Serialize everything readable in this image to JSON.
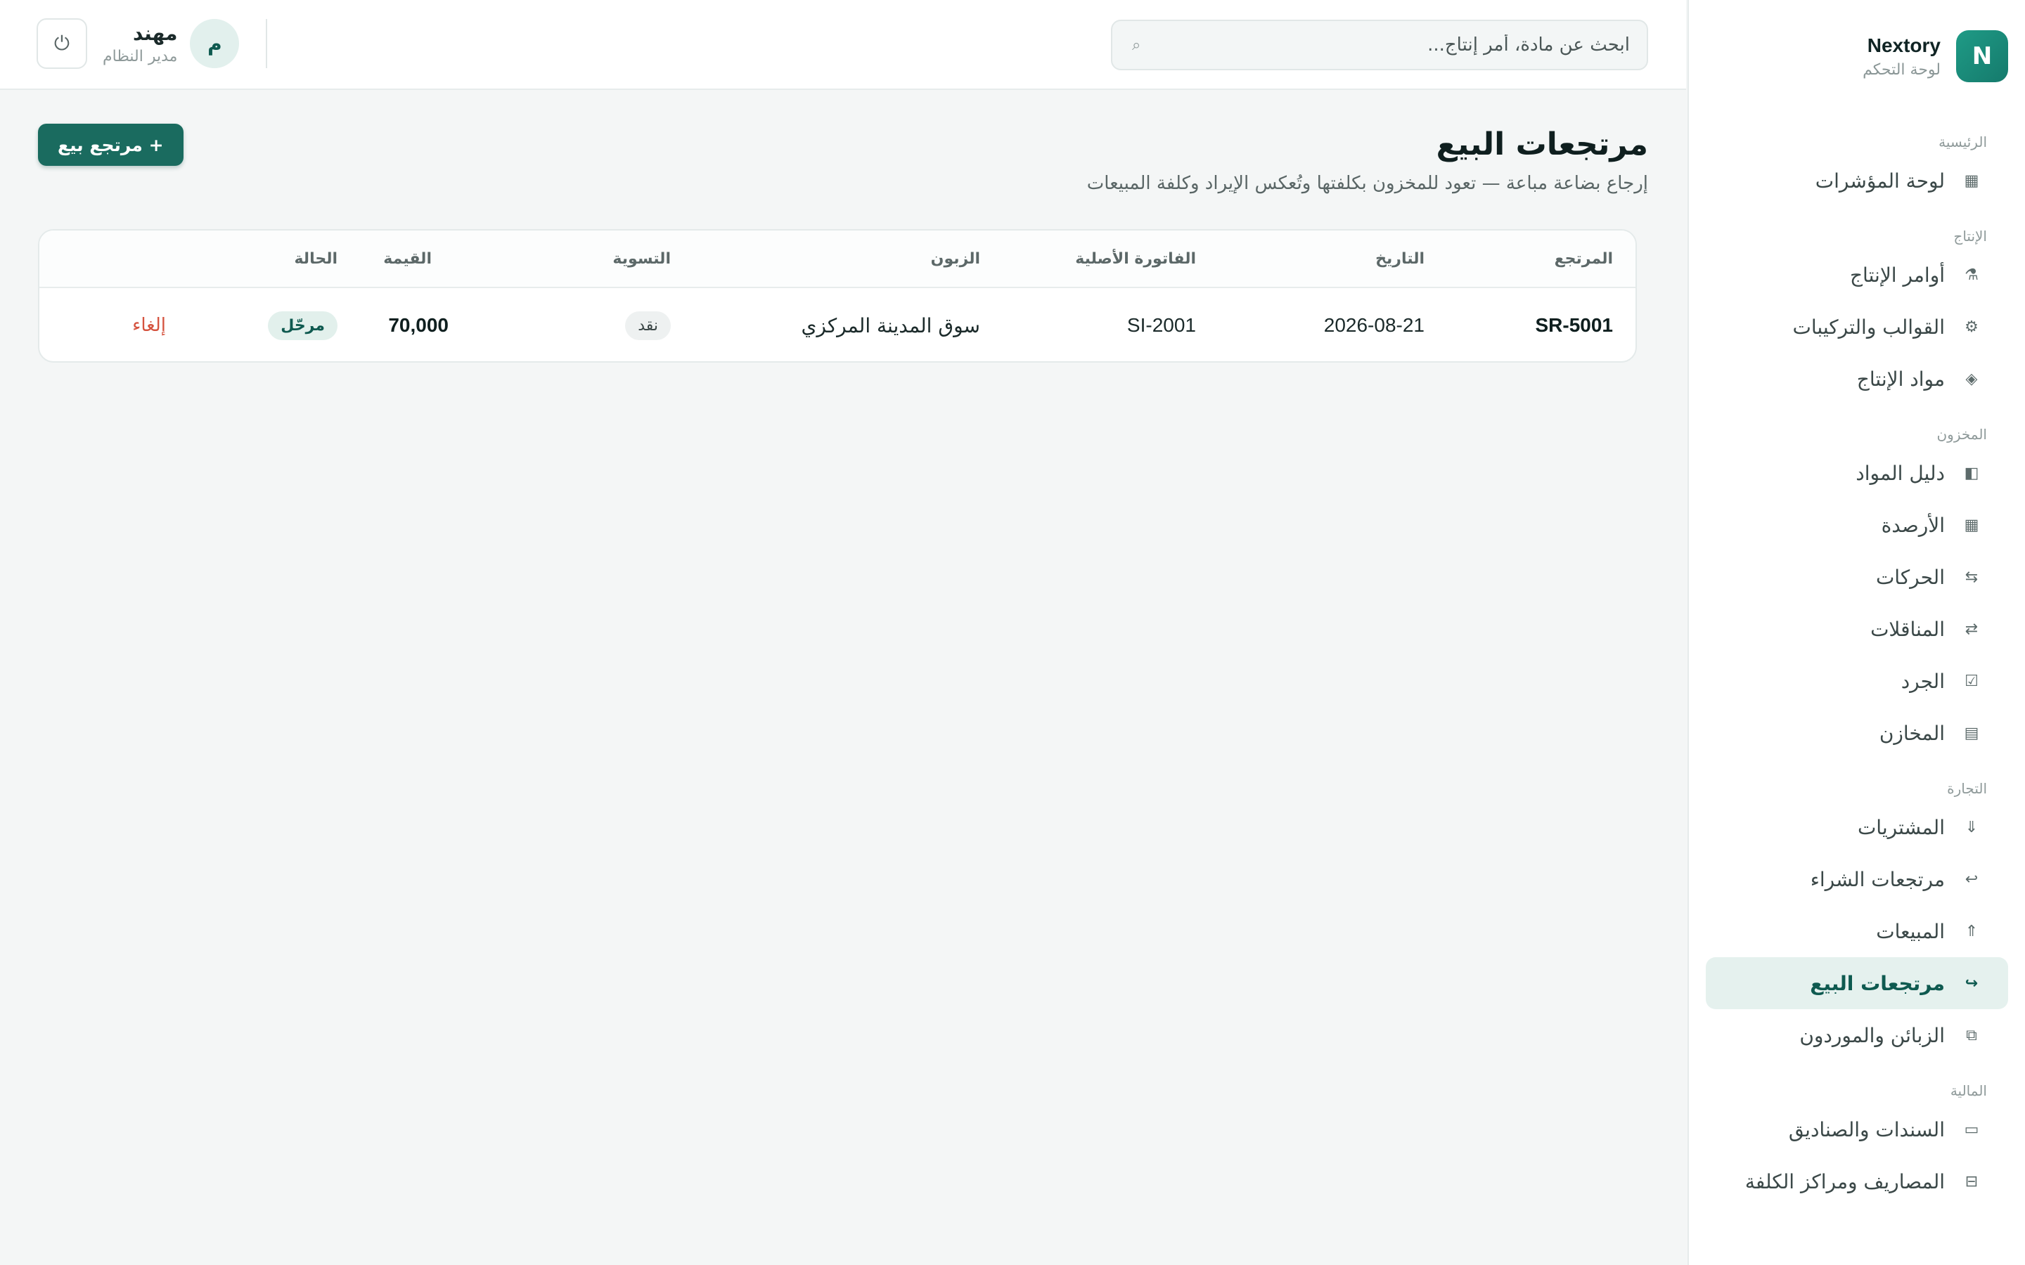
{
  "brand": {
    "logo_letter": "N",
    "name": "Nextory",
    "subtitle": "لوحة التحكم"
  },
  "sidebar": {
    "sections": [
      {
        "heading": "الرئيسية",
        "items": [
          {
            "label": "لوحة المؤشرات",
            "icon": "grid-icon",
            "glyph": "▦"
          }
        ]
      },
      {
        "heading": "الإنتاج",
        "items": [
          {
            "label": "أوامر الإنتاج",
            "icon": "factory-icon",
            "glyph": "⚗"
          },
          {
            "label": "القوالب والتركيبات",
            "icon": "gear-icon",
            "glyph": "⚙"
          },
          {
            "label": "مواد الإنتاج",
            "icon": "diamond-icon",
            "glyph": "◈"
          }
        ]
      },
      {
        "heading": "المخزون",
        "items": [
          {
            "label": "دليل المواد",
            "icon": "book-icon",
            "glyph": "◧"
          },
          {
            "label": "الأرصدة",
            "icon": "grid-icon",
            "glyph": "▦"
          },
          {
            "label": "الحركات",
            "icon": "movements-icon",
            "glyph": "⇆"
          },
          {
            "label": "المناقلات",
            "icon": "transfer-icon",
            "glyph": "⇄"
          },
          {
            "label": "الجرد",
            "icon": "checkbox-icon",
            "glyph": "☑"
          },
          {
            "label": "المخازن",
            "icon": "warehouse-icon",
            "glyph": "▤"
          }
        ]
      },
      {
        "heading": "التجارة",
        "items": [
          {
            "label": "المشتريات",
            "icon": "arrow-down-icon",
            "glyph": "⇓"
          },
          {
            "label": "مرتجعات الشراء",
            "icon": "return-icon",
            "glyph": "↩"
          },
          {
            "label": "المبيعات",
            "icon": "arrow-up-icon",
            "glyph": "⇑"
          },
          {
            "label": "مرتجعات البيع",
            "icon": "sales-return-icon",
            "glyph": "↪",
            "active": true
          },
          {
            "label": "الزبائن والموردون",
            "icon": "contacts-icon",
            "glyph": "⧉"
          }
        ]
      },
      {
        "heading": "المالية",
        "items": [
          {
            "label": "السندات والصناديق",
            "icon": "cash-icon",
            "glyph": "▭"
          },
          {
            "label": "المصاريف ومراكز الكلفة",
            "icon": "expenses-icon",
            "glyph": "⊟"
          }
        ]
      }
    ]
  },
  "header": {
    "search_placeholder": "ابحث عن مادة، أمر إنتاج...",
    "user": {
      "initial": "م",
      "name": "مهند",
      "role": "مدير النظام"
    }
  },
  "page": {
    "title": "مرتجعات البيع",
    "subtitle": "إرجاع بضاعة مباعة — تعود للمخزون بكلفتها وتُعكس الإيراد وكلفة المبيعات",
    "add_button": "+ مرتجع بيع"
  },
  "table": {
    "headers": {
      "ref": "المرتجع",
      "date": "التاريخ",
      "invoice": "الفاتورة الأصلية",
      "customer": "الزبون",
      "settlement": "التسوية",
      "value": "القيمة",
      "status": "الحالة"
    },
    "rows": [
      {
        "ref": "SR-5001",
        "date": "2026-08-21",
        "invoice": "SI-2001",
        "customer": "سوق المدينة المركزي",
        "settlement": "نقد",
        "value": "70,000",
        "status": "مرحّل",
        "action": "إلغاء"
      }
    ]
  },
  "colors": {
    "accent": "#1a6b5f",
    "danger": "#d5533f",
    "active_bg": "#e5f1ee"
  }
}
